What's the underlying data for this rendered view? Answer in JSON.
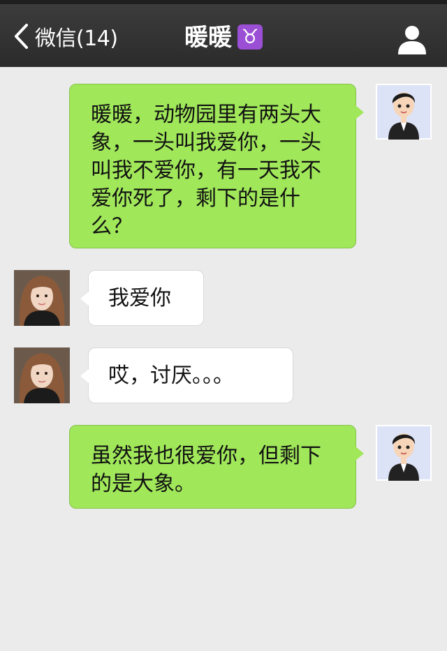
{
  "nav": {
    "back_label": "微信(14)",
    "title": "暖暖",
    "zodiac_symbol": "♉",
    "zodiac_color": "#9b4fd4"
  },
  "colors": {
    "background": "#ebebeb",
    "nav_bar": "#2e2e2e",
    "sent_bubble": "#a0e75a",
    "received_bubble": "#ffffff"
  },
  "messages": [
    {
      "sender": "me",
      "text": "暖暖，动物园里有两头大象，一头叫我爱你，一头叫我不爱你，有一天我不爱你死了，剩下的是什么？"
    },
    {
      "sender": "contact",
      "text": "我爱你"
    },
    {
      "sender": "contact",
      "text": "哎，讨厌。。。"
    },
    {
      "sender": "me",
      "text": "虽然我也很爱你，但剩下的是大象。"
    }
  ]
}
